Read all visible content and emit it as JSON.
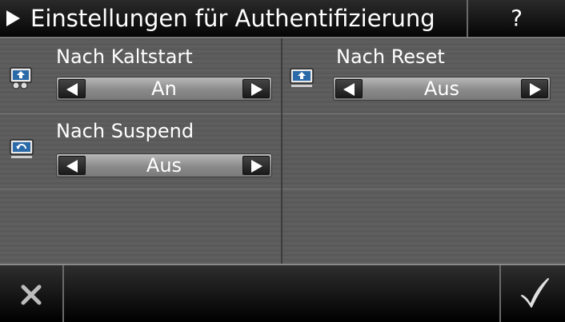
{
  "header": {
    "title": "Einstellungen für Authentifizierung",
    "help_label": "?"
  },
  "settings": [
    {
      "label": "Nach Kaltstart",
      "value": "An",
      "icon": "cold-start-icon"
    },
    {
      "label": "Nach Reset",
      "value": "Aus",
      "icon": "reset-icon"
    },
    {
      "label": "Nach Suspend",
      "value": "Aus",
      "icon": "suspend-icon"
    }
  ],
  "footer": {
    "cancel_icon": "close-icon",
    "ok_icon": "checkmark-icon"
  },
  "colors": {
    "background": "#5c5c5c",
    "header": "#000000",
    "selector": "#9e9e9e"
  }
}
